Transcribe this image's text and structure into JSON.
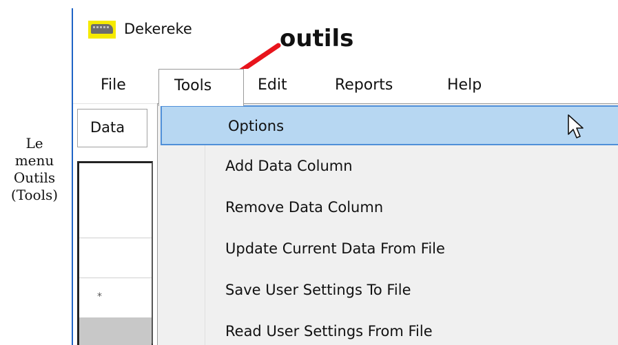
{
  "caption": {
    "lines": [
      "Le",
      "menu",
      "Outils",
      "(Tools)"
    ]
  },
  "window": {
    "title": "Dekereke",
    "icon": "bus-icon"
  },
  "annotation": {
    "text": "outils",
    "arrow_color": "#e8141c"
  },
  "menubar": {
    "items": [
      "File",
      "Tools",
      "Edit",
      "Reports",
      "Help"
    ],
    "active": "Tools"
  },
  "data_tab": {
    "label": "Data"
  },
  "grid": {
    "row_marker": "*"
  },
  "tools_menu": {
    "items": [
      "Options",
      "Add Data Column",
      "Remove Data Column",
      "Update Current Data From File",
      "Save User Settings To File",
      "Read User Settings From File"
    ],
    "highlighted": "Options"
  },
  "colors": {
    "highlight_fill": "#b7d7f2",
    "highlight_border": "#4f8fd8",
    "window_border": "#1e63c6",
    "icon_bg": "#f5ea00"
  }
}
